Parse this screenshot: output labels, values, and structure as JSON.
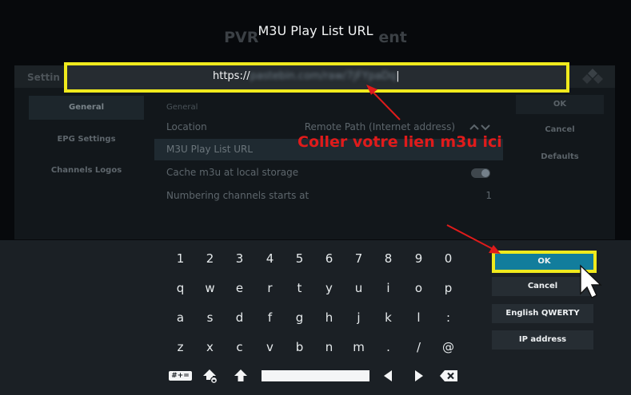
{
  "background": {
    "title_prefix": "PVR",
    "title_suffix": "ent",
    "subtitle": "",
    "header_label": "Settin",
    "group_label": "General",
    "tabs": [
      "General",
      "EPG Settings",
      "Channels Logos"
    ],
    "rows": [
      {
        "label": "Location",
        "value": "Remote Path (Internet address)"
      },
      {
        "label": "M3U Play List URL",
        "value": ""
      },
      {
        "label": "Cache m3u at local storage",
        "value": ""
      },
      {
        "label": "Numbering channels starts at",
        "value": "1"
      }
    ],
    "right_buttons": [
      "OK",
      "Cancel",
      "Defaults"
    ]
  },
  "dialog": {
    "title": "M3U Play List URL",
    "input_prefix": "https://",
    "input_obscured": "pastebin.com/raw/7jFYpaDq"
  },
  "annotation": {
    "text": "Coller  votre lien m3u ici",
    "color": "#e01b1b"
  },
  "keyboard": {
    "rows": [
      [
        "1",
        "2",
        "3",
        "4",
        "5",
        "6",
        "7",
        "8",
        "9",
        "0"
      ],
      [
        "q",
        "w",
        "e",
        "r",
        "t",
        "y",
        "u",
        "i",
        "o",
        "p"
      ],
      [
        "a",
        "s",
        "d",
        "f",
        "g",
        "h",
        "j",
        "k",
        "l",
        ":"
      ],
      [
        "z",
        "x",
        "c",
        "v",
        "b",
        "n",
        "m",
        ".",
        "/",
        "@"
      ]
    ],
    "symbols_label": "#+=",
    "buttons": {
      "ok": "OK",
      "cancel": "Cancel",
      "layout": "English QWERTY",
      "ip": "IP address"
    }
  },
  "colors": {
    "highlight": "#f0ea1d",
    "ok_button": "#127d9c",
    "arrow": "#e01b1b"
  },
  "icons": [
    "kodi-logo-icon",
    "shift-icon",
    "caps-lock-icon",
    "arrow-left-icon",
    "arrow-right-icon",
    "backspace-icon",
    "mouse-cursor-icon"
  ]
}
